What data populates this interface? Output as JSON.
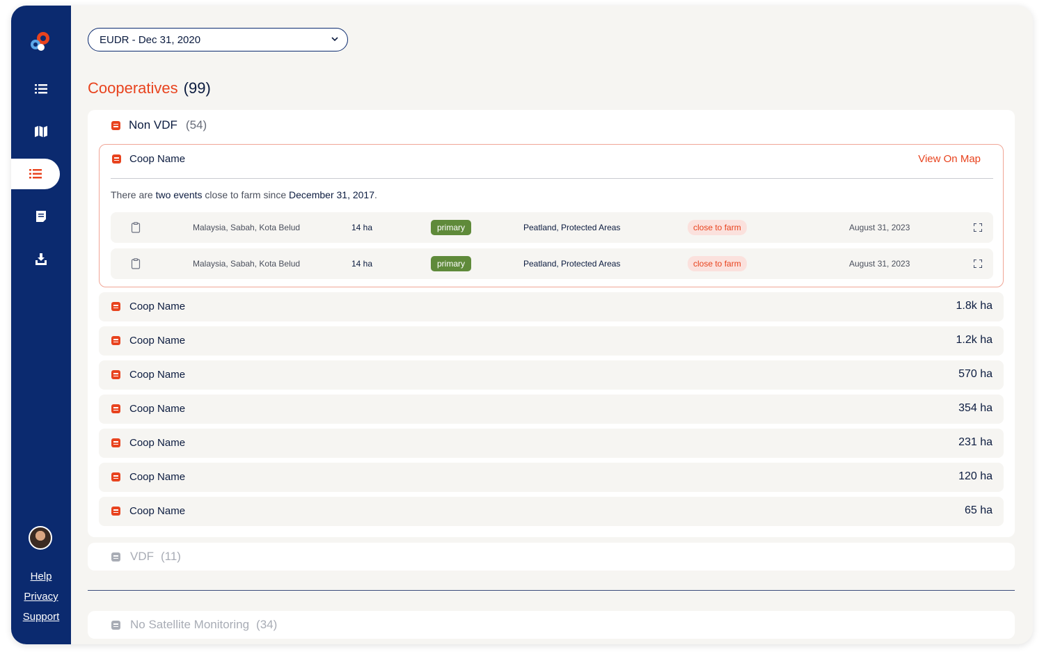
{
  "filter": {
    "selected": "EUDR - Dec 31, 2020"
  },
  "heading": {
    "title": "Cooperatives",
    "count": "(99)"
  },
  "groups": {
    "non_vdf": {
      "label": "Non VDF",
      "count": "(54)"
    },
    "vdf": {
      "label": "VDF",
      "count": "(11)"
    },
    "no_sat": {
      "label": "No Satellite Monitoring",
      "count": "(34)"
    }
  },
  "expanded": {
    "name": "Coop Name",
    "view_on_map": "View On Map",
    "summary_pre": "There are ",
    "summary_bold1": "two events",
    "summary_mid": " close to farm since ",
    "summary_bold2": "December 31, 2017",
    "summary_post": ".",
    "events": [
      {
        "location": "Malaysia, Sabah, Kota Belud",
        "area": "14 ha",
        "type": "primary",
        "zone": "Peatland, Protected Areas",
        "status": "close to farm",
        "date": "August 31, 2023"
      },
      {
        "location": "Malaysia, Sabah, Kota Belud",
        "area": "14 ha",
        "type": "primary",
        "zone": "Peatland, Protected Areas",
        "status": "close to farm",
        "date": "August 31, 2023"
      }
    ]
  },
  "coops": [
    {
      "name": "Coop Name",
      "area": "1.8k ha"
    },
    {
      "name": "Coop Name",
      "area": "1.2k ha"
    },
    {
      "name": "Coop Name",
      "area": "570 ha"
    },
    {
      "name": "Coop Name",
      "area": "354 ha"
    },
    {
      "name": "Coop Name",
      "area": "231 ha"
    },
    {
      "name": "Coop Name",
      "area": "120 ha"
    },
    {
      "name": "Coop Name",
      "area": "65 ha"
    }
  ],
  "sidebar": {
    "nav": [
      "list-icon",
      "map-icon",
      "list-active-icon",
      "document-icon",
      "download-icon"
    ],
    "links": {
      "help": "Help",
      "privacy": "Privacy",
      "support": "Support"
    }
  },
  "colors": {
    "navy": "#0b2a6f",
    "accent": "#e8431e",
    "primary_tag": "#5f8a3a"
  }
}
